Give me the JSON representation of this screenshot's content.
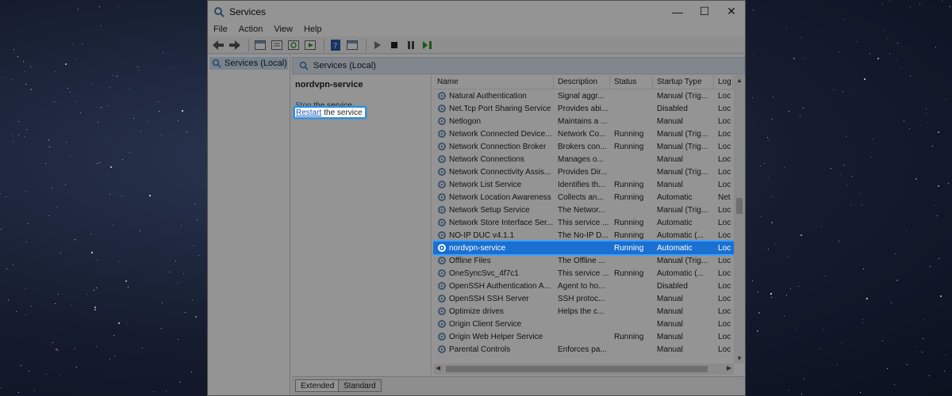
{
  "window": {
    "title": "Services",
    "controls": {
      "minimize": "—",
      "maximize": "☐",
      "close": "✕"
    }
  },
  "menu": [
    "File",
    "Action",
    "View",
    "Help"
  ],
  "tree": {
    "item": "Services (Local)"
  },
  "pane_header": "Services (Local)",
  "detail": {
    "service_name": "nordvpn-service",
    "stop_link": "Stop",
    "stop_rest": "the service",
    "restart_link": "Restart",
    "restart_rest": "the service"
  },
  "columns": [
    "Name",
    "Description",
    "Status",
    "Startup Type",
    "Log"
  ],
  "rows": [
    [
      "Natural Authentication",
      "Signal aggr...",
      "",
      "Manual (Trig...",
      "Loc"
    ],
    [
      "Net.Tcp Port Sharing Service",
      "Provides abi...",
      "",
      "Disabled",
      "Loc"
    ],
    [
      "Netlogon",
      "Maintains a ...",
      "",
      "Manual",
      "Loc"
    ],
    [
      "Network Connected Device...",
      "Network Co...",
      "Running",
      "Manual (Trig...",
      "Loc"
    ],
    [
      "Network Connection Broker",
      "Brokers con...",
      "Running",
      "Manual (Trig...",
      "Loc"
    ],
    [
      "Network Connections",
      "Manages o...",
      "",
      "Manual",
      "Loc"
    ],
    [
      "Network Connectivity Assis...",
      "Provides Dir...",
      "",
      "Manual (Trig...",
      "Loc"
    ],
    [
      "Network List Service",
      "Identifies th...",
      "Running",
      "Manual",
      "Loc"
    ],
    [
      "Network Location Awareness",
      "Collects an...",
      "Running",
      "Automatic",
      "Net"
    ],
    [
      "Network Setup Service",
      "The Networ...",
      "",
      "Manual (Trig...",
      "Loc"
    ],
    [
      "Network Store Interface Ser...",
      "This service ...",
      "Running",
      "Automatic",
      "Loc"
    ],
    [
      "NO-IP DUC v4.1.1",
      "The No-IP D...",
      "Running",
      "Automatic (...",
      "Loc"
    ],
    [
      "nordvpn-service",
      "",
      "Running",
      "Automatic",
      "Loc"
    ],
    [
      "Offline Files",
      "The Offline ...",
      "",
      "Manual (Trig...",
      "Loc"
    ],
    [
      "OneSyncSvc_4f7c1",
      "This service ...",
      "Running",
      "Automatic (...",
      "Loc"
    ],
    [
      "OpenSSH Authentication A...",
      "Agent to ho...",
      "",
      "Disabled",
      "Loc"
    ],
    [
      "OpenSSH SSH Server",
      "SSH protoc...",
      "",
      "Manual",
      "Loc"
    ],
    [
      "Optimize drives",
      "Helps the c...",
      "",
      "Manual",
      "Loc"
    ],
    [
      "Origin Client Service",
      "",
      "",
      "Manual",
      "Loc"
    ],
    [
      "Origin Web Helper Service",
      "",
      "Running",
      "Manual",
      "Loc"
    ],
    [
      "Parental Controls",
      "Enforces pa...",
      "",
      "Manual",
      "Loc"
    ]
  ],
  "selected_row_index": 12,
  "tabs": {
    "extended": "Extended",
    "standard": "Standard"
  },
  "colors": {
    "highlight": "#2b8fe0",
    "selected_row": "#1a6fd0"
  }
}
